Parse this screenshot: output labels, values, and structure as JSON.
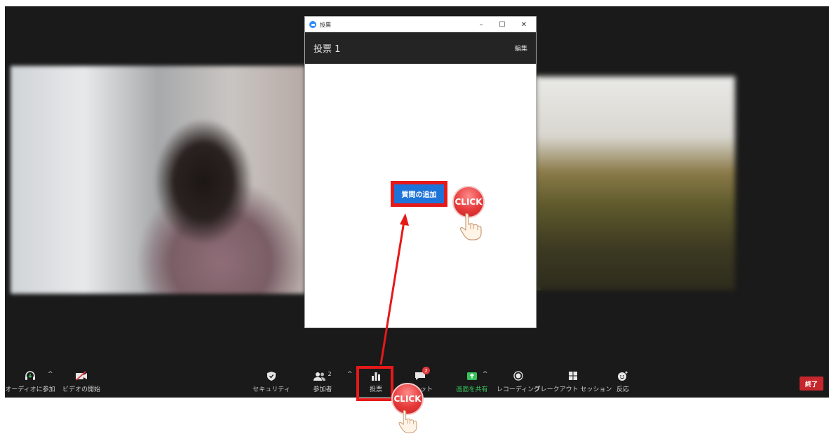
{
  "poll_window": {
    "window_title": "投票",
    "minimize": "–",
    "maximize": "☐",
    "close": "✕",
    "poll_title": "投票 1",
    "edit_label": "編集",
    "add_question_label": "質問の追加"
  },
  "toolbar": {
    "audio_label": "オーディオに参加",
    "video_label": "ビデオの開始",
    "security_label": "セキュリティ",
    "participants_label": "参加者",
    "participants_count": "2",
    "poll_label": "投票",
    "chat_label": "チャット",
    "chat_badge": "2",
    "share_label": "画面を共有",
    "record_label": "レコーディング",
    "breakout_label": "ブレークアウト セッション",
    "reactions_label": "反応",
    "end_label": "終了"
  },
  "annotations": {
    "click_text": "CLICK"
  },
  "colors": {
    "meeting_bg": "#1a1a1a",
    "accent_blue": "#1e73d9",
    "highlight_red": "#e61919",
    "share_green": "#36c25b",
    "end_red": "#c5272c"
  }
}
